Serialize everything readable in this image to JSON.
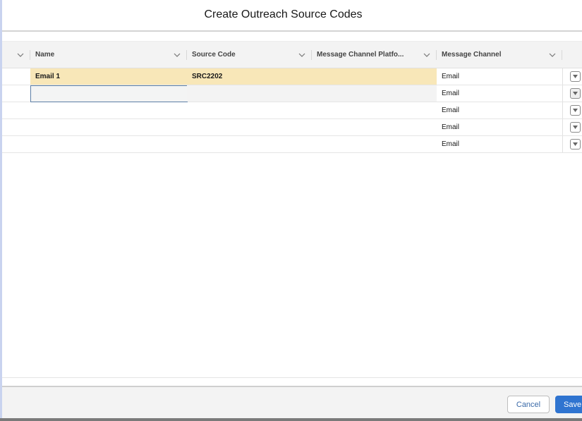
{
  "modal": {
    "title": "Create Outreach Source Codes"
  },
  "grid": {
    "columns": [
      {
        "label": ""
      },
      {
        "label": "Name"
      },
      {
        "label": "Source Code"
      },
      {
        "label": "Message Channel Platfo..."
      },
      {
        "label": "Message Channel"
      }
    ],
    "rows": [
      {
        "name": "Email 1",
        "source_code": "SRC2202",
        "platform": "",
        "channel": "Email",
        "state": "highlighted"
      },
      {
        "name": "",
        "source_code": "",
        "platform": "",
        "channel": "Email",
        "state": "editing"
      },
      {
        "name": "",
        "source_code": "",
        "platform": "",
        "channel": "Email",
        "state": "normal"
      },
      {
        "name": "",
        "source_code": "",
        "platform": "",
        "channel": "Email",
        "state": "normal"
      },
      {
        "name": "",
        "source_code": "",
        "platform": "",
        "channel": "Email",
        "state": "normal"
      }
    ]
  },
  "icons": {
    "column_menu": "chevron-down-icon",
    "row_action": "caret-down-icon"
  },
  "footer": {
    "cancel_label": "Cancel",
    "save_label": "Save"
  },
  "colors": {
    "highlight": "#f8e7b8",
    "edit_border": "#5d7fa6",
    "primary_button": "#2f74d0",
    "header_bg": "#f3f3f3"
  }
}
